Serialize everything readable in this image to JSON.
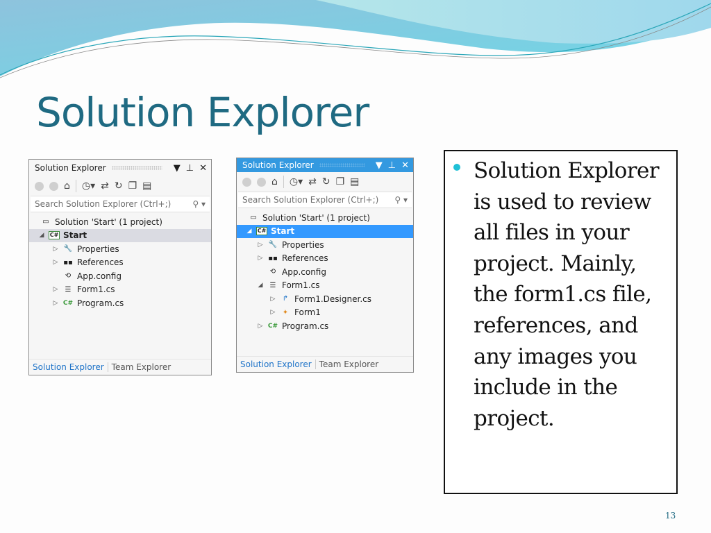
{
  "slide": {
    "title": "Solution Explorer",
    "page_number": "13",
    "bullet_text": "Solution Explorer is used to review all files in your project. Mainly, the form1.cs file, references, and any images you include in the project.",
    "accent_color": "#1fc0d6",
    "title_color": "#1f6a82"
  },
  "panel_left": {
    "title": "Solution Explorer",
    "controls": {
      "dropdown": "▼",
      "pin": "⊥",
      "close": "✕"
    },
    "search_placeholder": "Search Solution Explorer (Ctrl+;)",
    "search_icon": "⚲ ▾",
    "tree": [
      {
        "label": "Solution 'Start' (1 project)",
        "icon": "▭",
        "expander": ""
      },
      {
        "label": "Start",
        "icon": "C#",
        "expander": "◢"
      },
      {
        "label": "Properties",
        "icon": "🔧",
        "expander": "▷"
      },
      {
        "label": "References",
        "icon": "▪▪",
        "expander": "▷"
      },
      {
        "label": "App.config",
        "icon": "⟲",
        "expander": ""
      },
      {
        "label": "Form1.cs",
        "icon": "☰",
        "expander": "▷"
      },
      {
        "label": "Program.cs",
        "icon": "C#",
        "expander": "▷"
      }
    ],
    "tabs": [
      "Solution Explorer",
      "Team Explorer"
    ]
  },
  "panel_right": {
    "title": "Solution Explorer",
    "controls": {
      "dropdown": "▼",
      "pin": "⊥",
      "close": "✕"
    },
    "search_placeholder": "Search Solution Explorer (Ctrl+;)",
    "search_icon": "⚲ ▾",
    "tree": [
      {
        "label": "Solution 'Start' (1 project)",
        "icon": "▭",
        "expander": ""
      },
      {
        "label": "Start",
        "icon": "C#",
        "expander": "◢"
      },
      {
        "label": "Properties",
        "icon": "🔧",
        "expander": "▷"
      },
      {
        "label": "References",
        "icon": "▪▪",
        "expander": "▷"
      },
      {
        "label": "App.config",
        "icon": "⟲",
        "expander": ""
      },
      {
        "label": "Form1.cs",
        "icon": "☰",
        "expander": "◢"
      },
      {
        "label": "Form1.Designer.cs",
        "icon": "↱",
        "expander": "▷"
      },
      {
        "label": "Form1",
        "icon": "✦",
        "expander": "▷"
      },
      {
        "label": "Program.cs",
        "icon": "C#",
        "expander": "▷"
      }
    ],
    "tabs": [
      "Solution Explorer",
      "Team Explorer"
    ]
  }
}
